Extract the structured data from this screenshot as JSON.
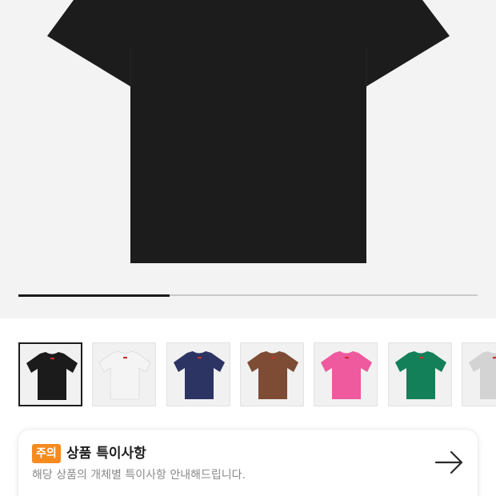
{
  "hero": {
    "image": "black-tshirt-front",
    "background": "#f3f3f3",
    "slide_progress": 0.33
  },
  "thumbnails": [
    {
      "name": "black-tshirt-thumbnail",
      "color": "#1b1b1b",
      "logo": "#c8302c",
      "selected": true
    },
    {
      "name": "white-tshirt-thumbnail",
      "color": "#f4f4f4",
      "logo": "#c8302c",
      "selected": false
    },
    {
      "name": "navy-tshirt-thumbnail",
      "color": "#2b3463",
      "logo": "#c8302c",
      "selected": false
    },
    {
      "name": "brown-tshirt-thumbnail",
      "color": "#7e4b35",
      "logo": "#c8302c",
      "selected": false
    },
    {
      "name": "pink-tshirt-thumbnail",
      "color": "#ee5a9d",
      "logo": "#c8302c",
      "selected": false
    },
    {
      "name": "green-tshirt-thumbnail",
      "color": "#148059",
      "logo": "#c8302c",
      "selected": false
    },
    {
      "name": "grey-tshirt-thumbnail",
      "color": "#d3d3d3",
      "logo": "#c8302c",
      "selected": false
    }
  ],
  "notice": {
    "badge": "주의",
    "badge_color": "#f58a1f",
    "title": "상품 특이사항",
    "description": "해당 상품의 개체별 특이사항 안내해드립니다.",
    "arrow_icon": "arrow-right-icon"
  }
}
